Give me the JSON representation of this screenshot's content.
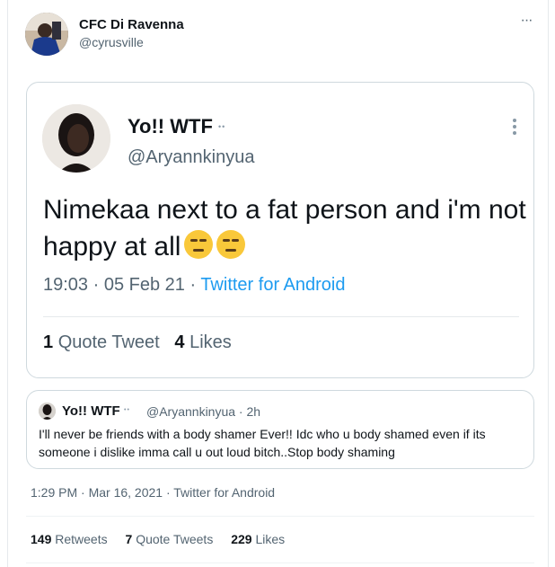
{
  "author": {
    "name": "CFC Di Ravenna",
    "handle": "@cyrusville"
  },
  "more_label": "···",
  "embedded_tweet": {
    "name": "Yo!! WTF",
    "eyes": "••",
    "handle": "@Aryannkinyua",
    "text": "Nimekaa next to a fat person and i'm not happy at all",
    "emoji": "unamused-face-icon",
    "time": "19:03 · 05 Feb 21 · ",
    "source": "Twitter for Android",
    "quote_count": "1",
    "quote_label": "Quote Tweet",
    "likes_count": "4",
    "likes_label": "Likes"
  },
  "quoted_reply": {
    "name": "Yo!! WTF",
    "eyes": "••",
    "handle_time": "@Aryannkinyua · 2h",
    "text": "I'll never be friends with a body shamer Ever!! Idc who u body shamed even if its someone i dislike imma call u out loud bitch..Stop body shaming"
  },
  "timestamp": "1:29 PM · Mar 16, 2021 · Twitter for Android",
  "stats": {
    "retweets_count": "149",
    "retweets_label": "Retweets",
    "quotes_count": "7",
    "quotes_label": "Quote Tweets",
    "likes_count": "229",
    "likes_label": "Likes"
  },
  "colors": {
    "accent": "#1d9bf0",
    "muted": "#536471",
    "border": "#cfd9de"
  }
}
